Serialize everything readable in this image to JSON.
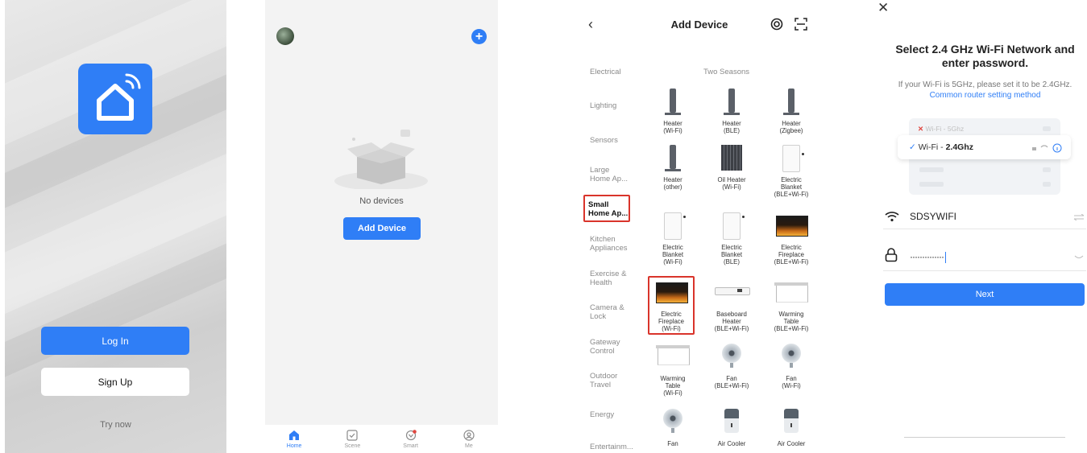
{
  "login": {
    "login_label": "Log In",
    "signup_label": "Sign Up",
    "try_now": "Try now"
  },
  "home": {
    "empty_text": "No devices",
    "add_device_label": "Add Device",
    "tabs": [
      {
        "label": "Home",
        "icon": "home-icon"
      },
      {
        "label": "Scene",
        "icon": "scene-checkbox-icon"
      },
      {
        "label": "Smart",
        "icon": "smart-icon"
      },
      {
        "label": "Me",
        "icon": "profile-icon"
      }
    ]
  },
  "add_device": {
    "title": "Add Device",
    "section_title": "Two Seasons",
    "categories": [
      "Electrical",
      "Lighting",
      "Sensors",
      "Large\nHome Ap...",
      "Small\nHome Ap...",
      "Kitchen\nAppliances",
      "Exercise &\nHealth",
      "Camera &\nLock",
      "Gateway\nControl",
      "Outdoor\nTravel",
      "Energy",
      "Entertainm..."
    ],
    "selected_category": "Small Home Ap...",
    "devices": [
      "Heater\n(Wi-Fi)",
      "Heater\n(BLE)",
      "Heater\n(Zigbee)",
      "Heater\n(other)",
      "Oil Heater\n(Wi-Fi)",
      "Electric\nBlanket\n(BLE+Wi-Fi)",
      "Electric\nBlanket\n(Wi-Fi)",
      "Electric\nBlanket\n(BLE)",
      "Electric\nFireplace\n(BLE+Wi-Fi)",
      "Electric\nFireplace\n(Wi-Fi)",
      "Baseboard\nHeater\n(BLE+Wi-Fi)",
      "Warming\nTable\n(BLE+Wi-Fi)",
      "Warming\nTable\n(Wi-Fi)",
      "Fan\n(BLE+Wi-Fi)",
      "Fan\n(Wi-Fi)",
      "Fan",
      "Air Cooler",
      "Air Cooler"
    ]
  },
  "wifi": {
    "title": "Select 2.4 GHz Wi-Fi Network and enter password.",
    "subtitle": "If your Wi-Fi is 5GHz, please set it to be 2.4GHz.",
    "link": "Common router setting method",
    "band_5g": "Wi-Fi - 5Ghz",
    "band_24_prefix": "Wi-Fi - ",
    "band_24_value": "2.4Ghz",
    "ssid": "SDSYWIFI",
    "password_masked": "··············",
    "next_label": "Next"
  },
  "colors": {
    "accent": "#2f7ef6",
    "highlight_red": "#d9342b"
  }
}
